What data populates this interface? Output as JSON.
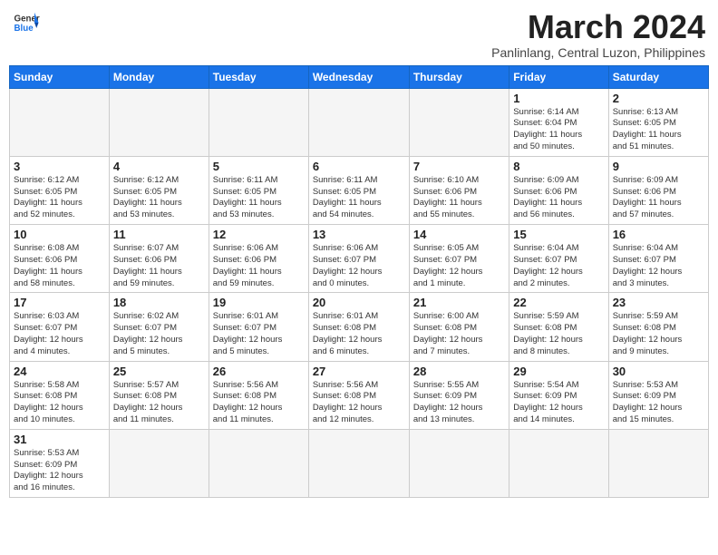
{
  "header": {
    "logo_general": "General",
    "logo_blue": "Blue",
    "month_title": "March 2024",
    "subtitle": "Panlinlang, Central Luzon, Philippines"
  },
  "weekdays": [
    "Sunday",
    "Monday",
    "Tuesday",
    "Wednesday",
    "Thursday",
    "Friday",
    "Saturday"
  ],
  "weeks": [
    [
      {
        "day": "",
        "info": ""
      },
      {
        "day": "",
        "info": ""
      },
      {
        "day": "",
        "info": ""
      },
      {
        "day": "",
        "info": ""
      },
      {
        "day": "",
        "info": ""
      },
      {
        "day": "1",
        "info": "Sunrise: 6:14 AM\nSunset: 6:04 PM\nDaylight: 11 hours\nand 50 minutes."
      },
      {
        "day": "2",
        "info": "Sunrise: 6:13 AM\nSunset: 6:05 PM\nDaylight: 11 hours\nand 51 minutes."
      }
    ],
    [
      {
        "day": "3",
        "info": "Sunrise: 6:12 AM\nSunset: 6:05 PM\nDaylight: 11 hours\nand 52 minutes."
      },
      {
        "day": "4",
        "info": "Sunrise: 6:12 AM\nSunset: 6:05 PM\nDaylight: 11 hours\nand 53 minutes."
      },
      {
        "day": "5",
        "info": "Sunrise: 6:11 AM\nSunset: 6:05 PM\nDaylight: 11 hours\nand 53 minutes."
      },
      {
        "day": "6",
        "info": "Sunrise: 6:11 AM\nSunset: 6:05 PM\nDaylight: 11 hours\nand 54 minutes."
      },
      {
        "day": "7",
        "info": "Sunrise: 6:10 AM\nSunset: 6:06 PM\nDaylight: 11 hours\nand 55 minutes."
      },
      {
        "day": "8",
        "info": "Sunrise: 6:09 AM\nSunset: 6:06 PM\nDaylight: 11 hours\nand 56 minutes."
      },
      {
        "day": "9",
        "info": "Sunrise: 6:09 AM\nSunset: 6:06 PM\nDaylight: 11 hours\nand 57 minutes."
      }
    ],
    [
      {
        "day": "10",
        "info": "Sunrise: 6:08 AM\nSunset: 6:06 PM\nDaylight: 11 hours\nand 58 minutes."
      },
      {
        "day": "11",
        "info": "Sunrise: 6:07 AM\nSunset: 6:06 PM\nDaylight: 11 hours\nand 59 minutes."
      },
      {
        "day": "12",
        "info": "Sunrise: 6:06 AM\nSunset: 6:06 PM\nDaylight: 11 hours\nand 59 minutes."
      },
      {
        "day": "13",
        "info": "Sunrise: 6:06 AM\nSunset: 6:07 PM\nDaylight: 12 hours\nand 0 minutes."
      },
      {
        "day": "14",
        "info": "Sunrise: 6:05 AM\nSunset: 6:07 PM\nDaylight: 12 hours\nand 1 minute."
      },
      {
        "day": "15",
        "info": "Sunrise: 6:04 AM\nSunset: 6:07 PM\nDaylight: 12 hours\nand 2 minutes."
      },
      {
        "day": "16",
        "info": "Sunrise: 6:04 AM\nSunset: 6:07 PM\nDaylight: 12 hours\nand 3 minutes."
      }
    ],
    [
      {
        "day": "17",
        "info": "Sunrise: 6:03 AM\nSunset: 6:07 PM\nDaylight: 12 hours\nand 4 minutes."
      },
      {
        "day": "18",
        "info": "Sunrise: 6:02 AM\nSunset: 6:07 PM\nDaylight: 12 hours\nand 5 minutes."
      },
      {
        "day": "19",
        "info": "Sunrise: 6:01 AM\nSunset: 6:07 PM\nDaylight: 12 hours\nand 5 minutes."
      },
      {
        "day": "20",
        "info": "Sunrise: 6:01 AM\nSunset: 6:08 PM\nDaylight: 12 hours\nand 6 minutes."
      },
      {
        "day": "21",
        "info": "Sunrise: 6:00 AM\nSunset: 6:08 PM\nDaylight: 12 hours\nand 7 minutes."
      },
      {
        "day": "22",
        "info": "Sunrise: 5:59 AM\nSunset: 6:08 PM\nDaylight: 12 hours\nand 8 minutes."
      },
      {
        "day": "23",
        "info": "Sunrise: 5:59 AM\nSunset: 6:08 PM\nDaylight: 12 hours\nand 9 minutes."
      }
    ],
    [
      {
        "day": "24",
        "info": "Sunrise: 5:58 AM\nSunset: 6:08 PM\nDaylight: 12 hours\nand 10 minutes."
      },
      {
        "day": "25",
        "info": "Sunrise: 5:57 AM\nSunset: 6:08 PM\nDaylight: 12 hours\nand 11 minutes."
      },
      {
        "day": "26",
        "info": "Sunrise: 5:56 AM\nSunset: 6:08 PM\nDaylight: 12 hours\nand 11 minutes."
      },
      {
        "day": "27",
        "info": "Sunrise: 5:56 AM\nSunset: 6:08 PM\nDaylight: 12 hours\nand 12 minutes."
      },
      {
        "day": "28",
        "info": "Sunrise: 5:55 AM\nSunset: 6:09 PM\nDaylight: 12 hours\nand 13 minutes."
      },
      {
        "day": "29",
        "info": "Sunrise: 5:54 AM\nSunset: 6:09 PM\nDaylight: 12 hours\nand 14 minutes."
      },
      {
        "day": "30",
        "info": "Sunrise: 5:53 AM\nSunset: 6:09 PM\nDaylight: 12 hours\nand 15 minutes."
      }
    ],
    [
      {
        "day": "31",
        "info": "Sunrise: 5:53 AM\nSunset: 6:09 PM\nDaylight: 12 hours\nand 16 minutes."
      },
      {
        "day": "",
        "info": ""
      },
      {
        "day": "",
        "info": ""
      },
      {
        "day": "",
        "info": ""
      },
      {
        "day": "",
        "info": ""
      },
      {
        "day": "",
        "info": ""
      },
      {
        "day": "",
        "info": ""
      }
    ]
  ]
}
